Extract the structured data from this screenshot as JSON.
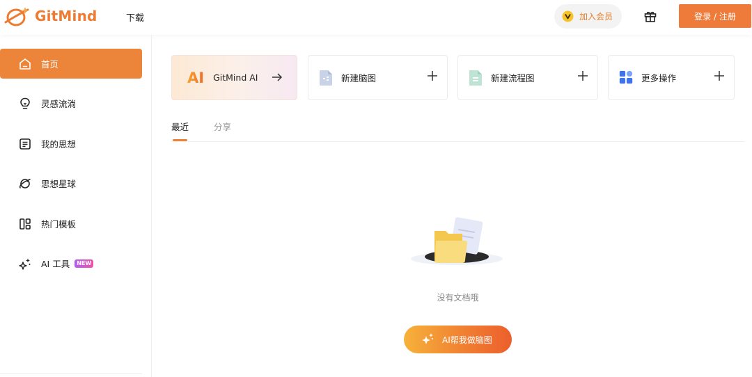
{
  "header": {
    "brand": "GitMind",
    "nav_download": "下载",
    "vip_label": "加入会员",
    "login_label": "登录 / 注册",
    "colors": {
      "accent": "#ee7b3a"
    }
  },
  "sidebar": {
    "items": [
      {
        "label": "首页",
        "icon": "home-icon",
        "active": true
      },
      {
        "label": "灵感流淌",
        "icon": "bulb-icon"
      },
      {
        "label": "我的思想",
        "icon": "document-icon"
      },
      {
        "label": "思想星球",
        "icon": "planet-icon"
      },
      {
        "label": "热门模板",
        "icon": "template-icon"
      },
      {
        "label": "AI 工具",
        "icon": "sparkle-icon",
        "badge": "NEW"
      }
    ]
  },
  "actions": {
    "ai_glyph": "AI",
    "ai_label": "GitMind AI",
    "new_mindmap": "新建脑图",
    "new_flowchart": "新建流程图",
    "more_actions": "更多操作"
  },
  "tabs": {
    "recent": "最近",
    "share": "分享"
  },
  "empty": {
    "message": "没有文档哦",
    "cta": "AI帮我做脑图"
  }
}
